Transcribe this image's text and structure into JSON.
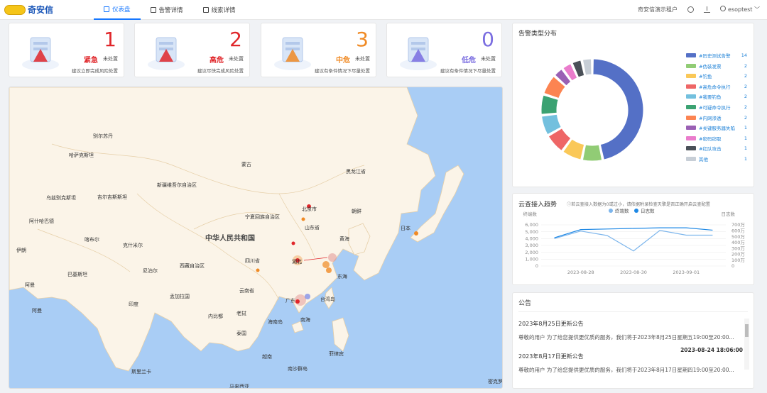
{
  "app": {
    "logo_text": "奇安信"
  },
  "nav": {
    "tabs": [
      {
        "label": "仪表盘",
        "active": true
      },
      {
        "label": "告警详情",
        "active": false
      },
      {
        "label": "线索详情",
        "active": false
      }
    ]
  },
  "header_right": {
    "tenant": "奇安信演示租户",
    "user": "esoptest"
  },
  "risk_cards": [
    {
      "count": "1",
      "level": "紧急",
      "status": "未处置",
      "advice": "建议立即完成风险处置",
      "color": "#e0262a"
    },
    {
      "count": "2",
      "level": "高危",
      "status": "未处置",
      "advice": "建议尽快完成风险处置",
      "color": "#e0262a"
    },
    {
      "count": "3",
      "level": "中危",
      "status": "未处置",
      "advice": "建议有条件情况下尽量处置",
      "color": "#f08a24"
    },
    {
      "count": "0",
      "level": "低危",
      "status": "未处置",
      "advice": "建议有条件情况下尽量处置",
      "color": "#7a6de0"
    }
  ],
  "map": {
    "labels": {
      "russia": "别尔苏丹",
      "kazakhstan": "哈萨克斯坦",
      "mongolia": "蒙古",
      "heilongjiang": "黑龙江省",
      "inner_mongolia": "内蒙古自治区",
      "xinjiang": "新疆维吾尔自治区",
      "uzbekistan": "乌兹别克斯坦",
      "kyrgyzstan": "吉尔吉斯斯坦",
      "turkmenistan": "阿什哈巴德",
      "tajikistan": "喀布尔",
      "afghanistan": "克什米尔",
      "ningxia": "宁夏回族自治区",
      "beijing": "北京市",
      "korea": "朝鲜",
      "shandong": "山东省",
      "yellow_sea": "黄海",
      "japan": "日本",
      "china": "中华人民共和国",
      "tibet": "西藏自治区",
      "sichuan": "四川省",
      "nepal": "尼泊尔",
      "hubei": "湖北",
      "east_sea": "东海",
      "pakistan": "巴基斯坦",
      "iran": "伊朗",
      "oman": "阿曼",
      "india": "印度",
      "bangladesh": "孟加拉国",
      "yunnan": "云南省",
      "guangdong": "广东",
      "taiwan": "台湾岛",
      "arabian": "阿曼",
      "hainan": "南海",
      "myanmar": "老挝",
      "thailand": "泰国",
      "laos": "内比都",
      "hainan_island": "海南岛",
      "vietnam": "越南",
      "philippines": "菲律宾",
      "sri_lanka": "斯里兰卡",
      "south_china_sea": "南沙群岛",
      "malaysia": "马来西亚",
      "micronesia": "密克罗尼",
      "yemen": "阿曼"
    }
  },
  "alert_types": {
    "title": "告警类型分布",
    "chart_data": {
      "type": "pie",
      "variant": "donut",
      "categories": [
        "#历史测试告警",
        "#伪装发票",
        "#钓鱼",
        "#高危命令执行",
        "#我要钓鱼",
        "#可疑命令执行",
        "#内网渗透",
        "#关键服务器失陷",
        "#密码窃取",
        "#红队攻击",
        "其他"
      ],
      "values": [
        14,
        2,
        2,
        2,
        2,
        2,
        2,
        1,
        1,
        1,
        1
      ],
      "colors": [
        "#5470c6",
        "#91cc75",
        "#fac858",
        "#ee6666",
        "#73c0de",
        "#3ba272",
        "#fc8452",
        "#9a60b4",
        "#ea7ccc",
        "#4a5058",
        "#c7ced6"
      ],
      "legend_position": "right"
    }
  },
  "cloud_trend": {
    "title": "云查接入趋势",
    "note": "ⓘ若云查接入数据为0或过小，请依据附录检查天擎是否正确开启云查配置",
    "left_axis_label": "终端数",
    "right_axis_label": "日志数",
    "chart_data": {
      "type": "line",
      "x": [
        "2023-08-27",
        "2023-08-28",
        "2023-08-29",
        "2023-08-30",
        "2023-08-31",
        "2023-09-01",
        "2023-09-02"
      ],
      "x_tick_labels": [
        "2023-08-28",
        "2023-08-30",
        "2023-09-01"
      ],
      "series": [
        {
          "name": "终端数",
          "axis": "left",
          "color": "#7cb5ec",
          "values": [
            4000,
            5100,
            4450,
            2200,
            5200,
            4500,
            4500
          ]
        },
        {
          "name": "日志数",
          "axis": "right",
          "color": "#1e88e5",
          "values": [
            4800000,
            6200000,
            6300000,
            6400000,
            6500000,
            6500000,
            6100000
          ]
        }
      ],
      "left_ylim": [
        0,
        6000
      ],
      "left_ticks": [
        "0",
        "1,000",
        "2,000",
        "3,000",
        "4,000",
        "5,000",
        "6,000"
      ],
      "right_ylim": [
        0,
        7000000
      ],
      "right_ticks": [
        "0",
        "100万",
        "200万",
        "300万",
        "400万",
        "500万",
        "600万",
        "700万"
      ],
      "grid": true,
      "legend_position": "top"
    }
  },
  "notices": {
    "title": "公告",
    "items": [
      {
        "title": "2023年8月25日更新公告",
        "body": "尊敬的用户 为了给您提供更优质的服务，我们将于2023年8月25日星期五19:00至20:00...",
        "date": "2023-08-24 18:06:00"
      },
      {
        "title": "2023年8月17日更新公告",
        "body": "尊敬的用户 为了给您提供更优质的服务，我们将于2023年8月17日星期四19:00至20:00..."
      }
    ]
  }
}
